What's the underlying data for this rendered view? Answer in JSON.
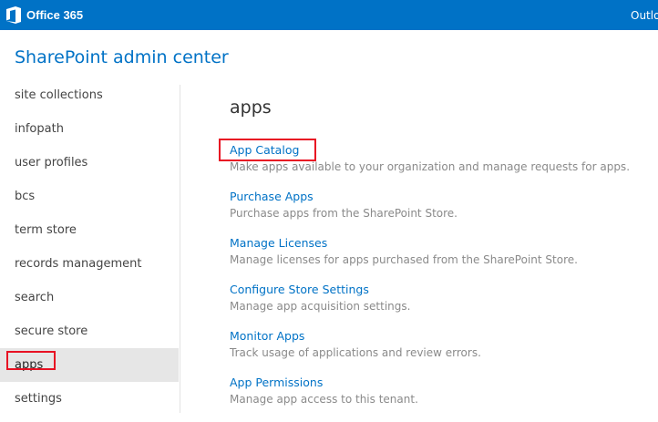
{
  "topbar": {
    "brand": "Office 365",
    "right_link": "Outlo",
    "bg_color": "#0072c6"
  },
  "app": {
    "title": "SharePoint admin center"
  },
  "sidebar": {
    "items": [
      {
        "label": "site collections",
        "selected": false
      },
      {
        "label": "infopath",
        "selected": false
      },
      {
        "label": "user profiles",
        "selected": false
      },
      {
        "label": "bcs",
        "selected": false
      },
      {
        "label": "term store",
        "selected": false
      },
      {
        "label": "records management",
        "selected": false
      },
      {
        "label": "search",
        "selected": false
      },
      {
        "label": "secure store",
        "selected": false
      },
      {
        "label": "apps",
        "selected": true
      },
      {
        "label": "settings",
        "selected": false
      }
    ]
  },
  "main": {
    "heading": "apps",
    "links": [
      {
        "title": "App Catalog",
        "description": "Make apps available to your organization and manage requests for apps."
      },
      {
        "title": "Purchase Apps",
        "description": "Purchase apps from the SharePoint Store."
      },
      {
        "title": "Manage Licenses",
        "description": "Manage licenses for apps purchased from the SharePoint Store."
      },
      {
        "title": "Configure Store Settings",
        "description": "Manage app acquisition settings."
      },
      {
        "title": "Monitor Apps",
        "description": "Track usage of applications and review errors."
      },
      {
        "title": "App Permissions",
        "description": "Manage app access to this tenant."
      }
    ]
  },
  "colors": {
    "accent": "#0072c6",
    "highlight_box": "#e81123",
    "selected_bg": "#e6e6e6",
    "description_text": "#8a8a8a"
  }
}
